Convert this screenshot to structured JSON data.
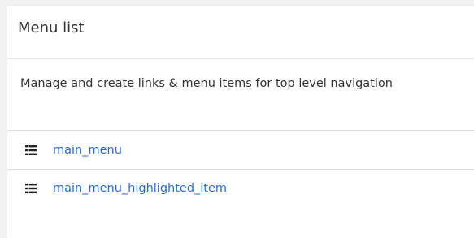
{
  "panel": {
    "title": "Menu list",
    "description": "Manage and create links & menu items for top level navigation"
  },
  "menus": [
    {
      "label": "main_menu",
      "icon": "list-icon",
      "hovered": false
    },
    {
      "label": "main_menu_highlighted_item",
      "icon": "list-icon",
      "hovered": true
    }
  ],
  "colors": {
    "link": "#2d6bcf",
    "text": "#333333",
    "divider": "#dedede"
  }
}
